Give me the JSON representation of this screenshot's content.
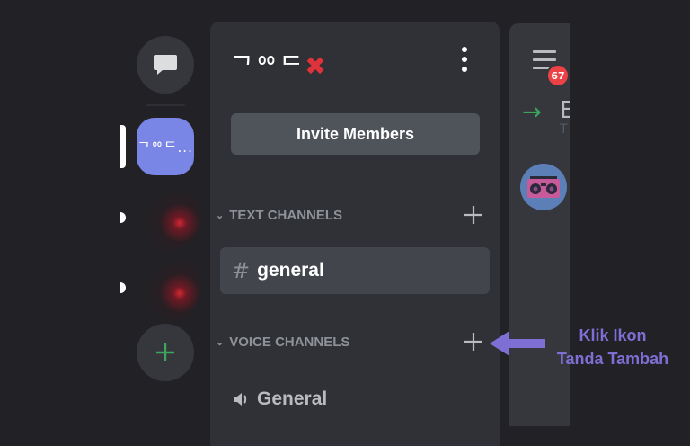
{
  "server": {
    "name": "ᄀᅇᄃ",
    "name_mark": "✖",
    "icon_text": "ᄀᅇᄃ..."
  },
  "panel": {
    "invite_label": "Invite Members",
    "categories": [
      {
        "label": "TEXT CHANNELS",
        "channels": [
          {
            "type": "text",
            "prefix": "#",
            "name": "general",
            "selected": true
          }
        ]
      },
      {
        "label": "VOICE CHANNELS",
        "channels": [
          {
            "type": "voice",
            "name": "General"
          }
        ]
      }
    ]
  },
  "right_panel": {
    "badge_count": "67",
    "partial_title": "E",
    "partial_subtitle": "T"
  },
  "annotation": {
    "line1": "Klik Ikon",
    "line2": "Tanda Tambah",
    "color": "#7e6fd4"
  },
  "icons": {
    "dm": "chat-bubble-icon",
    "add_server": "plus-icon",
    "kebab": "vertical-ellipsis-icon",
    "chevron": "chevron-down-icon",
    "add_channel": "plus-icon",
    "text_channel": "hash-icon",
    "voice_channel": "speaker-icon",
    "menu": "hamburger-icon",
    "arrow": "arrow-right-icon",
    "avatar": "boombox-icon"
  },
  "colors": {
    "background": "#222226",
    "panel": "#2f3136",
    "blurple": "#7a86e6",
    "green": "#3ba55c",
    "red": "#ed4245"
  }
}
